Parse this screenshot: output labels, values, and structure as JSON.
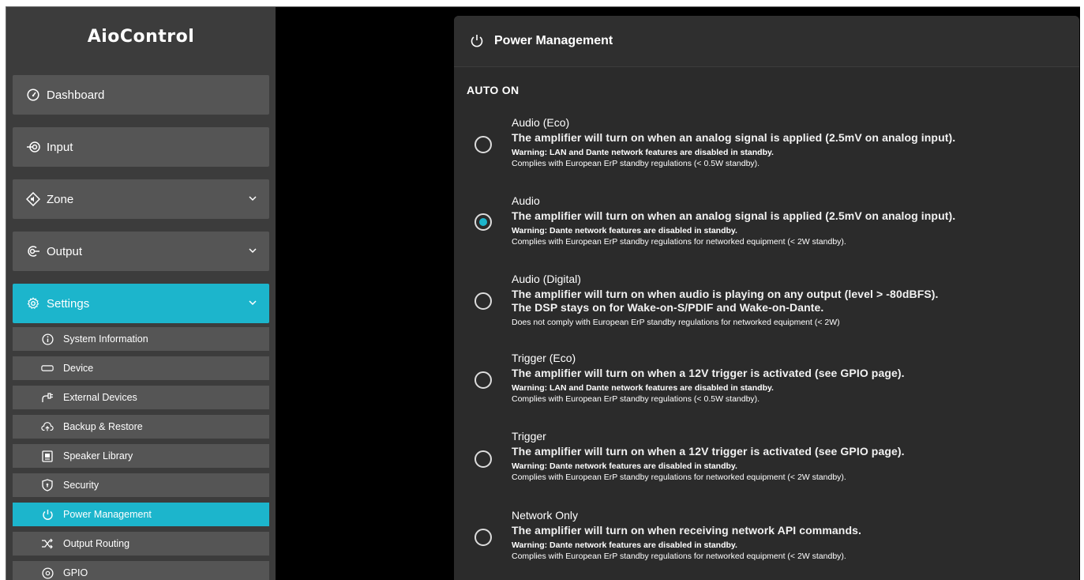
{
  "app": {
    "title": "AioControl"
  },
  "sidebar": {
    "items": [
      {
        "label": "Dashboard",
        "icon": "gauge-icon"
      },
      {
        "label": "Input",
        "icon": "input-icon"
      },
      {
        "label": "Zone",
        "icon": "zone-icon"
      },
      {
        "label": "Output",
        "icon": "output-icon"
      },
      {
        "label": "Settings",
        "icon": "gear-icon"
      }
    ],
    "settings_items": [
      {
        "label": "System Information",
        "icon": "info-icon"
      },
      {
        "label": "Device",
        "icon": "device-icon"
      },
      {
        "label": "External Devices",
        "icon": "plug-icon"
      },
      {
        "label": "Backup & Restore",
        "icon": "cloud-upload-icon"
      },
      {
        "label": "Speaker Library",
        "icon": "speaker-icon"
      },
      {
        "label": "Security",
        "icon": "shield-icon"
      },
      {
        "label": "Power Management",
        "icon": "power-icon"
      },
      {
        "label": "Output Routing",
        "icon": "shuffle-icon"
      },
      {
        "label": "GPIO",
        "icon": "gpio-icon"
      }
    ]
  },
  "panel": {
    "title": "Power Management",
    "section": "AUTO ON",
    "options": [
      {
        "title": "Audio (Eco)",
        "desc": "The amplifier will turn on when an analog signal is applied (2.5mV on analog input).",
        "desc2": "",
        "warning": "Warning: LAN and Dante network features are disabled in standby.",
        "note": "Complies with European ErP standby regulations (< 0.5W standby).",
        "checked": false
      },
      {
        "title": "Audio",
        "desc": "The amplifier will turn on when an analog signal is applied (2.5mV on analog input).",
        "desc2": "",
        "warning": "Warning: Dante network features are disabled in standby.",
        "note": "Complies with European ErP standby regulations for networked equipment (< 2W standby).",
        "checked": true
      },
      {
        "title": "Audio (Digital)",
        "desc": "The amplifier will turn on when audio is playing on any output (level > -80dBFS).",
        "desc2": "The DSP stays on for Wake-on-S/PDIF and Wake-on-Dante.",
        "warning": "",
        "note": "Does not comply with European ErP standby regulations for networked equipment (< 2W)",
        "checked": false
      },
      {
        "title": "Trigger (Eco)",
        "desc": "The amplifier will turn on when a 12V trigger is activated (see GPIO page).",
        "desc2": "",
        "warning": "Warning: LAN and Dante network features are disabled in standby.",
        "note": "Complies with European ErP standby regulations (< 0.5W standby).",
        "checked": false
      },
      {
        "title": "Trigger",
        "desc": "The amplifier will turn on when a 12V trigger is activated (see GPIO page).",
        "desc2": "",
        "warning": "Warning: Dante network features are disabled in standby.",
        "note": "Complies with European ErP standby regulations for networked equipment (< 2W standby).",
        "checked": false
      },
      {
        "title": "Network Only",
        "desc": "The amplifier will turn on when receiving network API commands.",
        "desc2": "",
        "warning": "Warning: Dante network features are disabled in standby.",
        "note": "Complies with European ErP standby regulations for networked equipment (< 2W standby).",
        "checked": false
      }
    ]
  },
  "colors": {
    "accent": "#1cb5cc",
    "sidebar_bg": "#3c3c3c",
    "item_bg": "#555555",
    "panel_bg": "#2b2b2b"
  }
}
